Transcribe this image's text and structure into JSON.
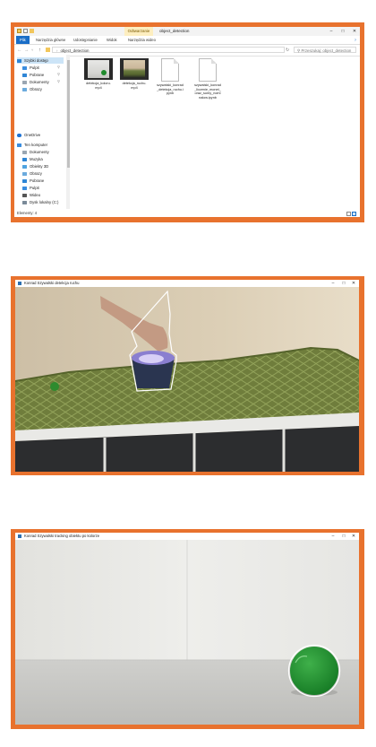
{
  "explorer": {
    "ctx_tab": "Odtwarzanie",
    "window_title": "object_detection",
    "ribbon_tabs": [
      "Plik",
      "Narzędzia główne",
      "Udostępnianie",
      "Widok",
      "Narzędzia wideo"
    ],
    "address_path": "object_detection",
    "search_placeholder": "Przeszukaj: object_detection",
    "nav_items": [
      {
        "label": "Szybki dostęp",
        "icon": "star-icon"
      },
      {
        "label": "Pulpit",
        "icon": "desktop-icon"
      },
      {
        "label": "Pobrane",
        "icon": "download-icon"
      },
      {
        "label": "Dokumenty",
        "icon": "documents-icon"
      },
      {
        "label": "Obrazy",
        "icon": "pictures-icon"
      },
      {
        "label": "OneDrive",
        "icon": "cloud-icon"
      },
      {
        "label": "Ten komputer",
        "icon": "computer-icon"
      },
      {
        "label": "Dokumenty",
        "icon": "documents-icon"
      },
      {
        "label": "Muzyka",
        "icon": "music-icon"
      },
      {
        "label": "Obiekty 3D",
        "icon": "cube-icon"
      },
      {
        "label": "Obrazy",
        "icon": "pictures-icon"
      },
      {
        "label": "Pobrane",
        "icon": "download-icon"
      },
      {
        "label": "Pulpit",
        "icon": "desktop-icon"
      },
      {
        "label": "Wideo",
        "icon": "video-icon"
      },
      {
        "label": "Dysk lokalny (C:)",
        "icon": "drive-icon"
      }
    ],
    "files": [
      {
        "name": "detekcja_koloru.mp4",
        "line1": "detekcja_koloru.",
        "line2": "mp4",
        "line3": "",
        "type": "video"
      },
      {
        "name": "detekcja_ruchu.mp4",
        "line1": "detekcja_ruchu.",
        "line2": "mp4",
        "line3": "",
        "type": "video"
      },
      {
        "name": "szywalski_konrad_detekcja_ruchu.ipynb",
        "line1": "szywalski_konrad",
        "line2": "_detekcja_ruchu.i",
        "line3": "pynb",
        "type": "document"
      },
      {
        "name": "szywalski_konrad_liczenie_monet_oraz_sumy_nominalow.ipynb",
        "line1": "szywalski_konrad",
        "line2": "_liczenie_monet_",
        "line3": "oraz_sumy_nomi",
        "line4": "nalow.ipynb",
        "type": "document"
      }
    ],
    "status": "Elementy: 4"
  },
  "camera1": {
    "title": "Konrad Szywalski detekcja ruchu"
  },
  "camera2": {
    "title": "Konrad Szywalski tracking obiektu po kolorze"
  },
  "colors": {
    "background_orange": "#e8722e",
    "accent_blue": "#1a6ec7",
    "contour_white": "#ffffff"
  }
}
